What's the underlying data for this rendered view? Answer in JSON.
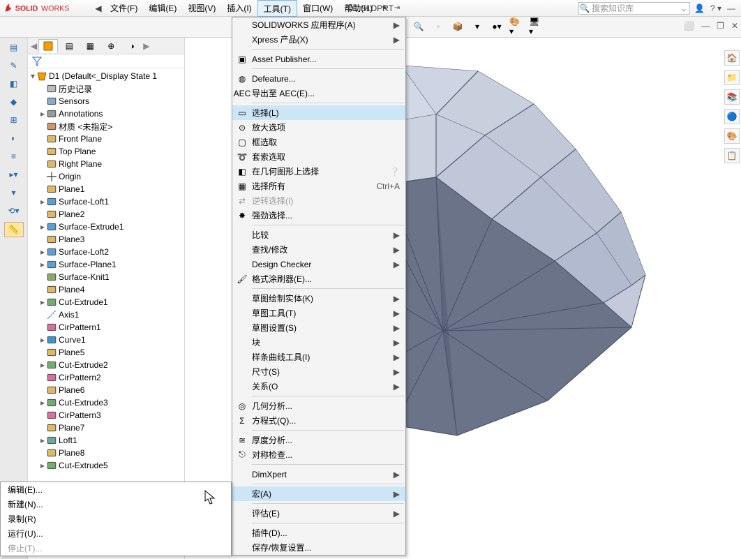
{
  "app": {
    "logo_main": "SOLID",
    "logo_sub": "WORKS",
    "title": "D1.SLDPRT"
  },
  "menubar": {
    "items": [
      "文件(F)",
      "编辑(E)",
      "视图(V)",
      "插入(I)",
      "工具(T)",
      "窗口(W)",
      "帮助(H)"
    ],
    "open_index": 4
  },
  "search": {
    "placeholder": "搜索知识库"
  },
  "feature_tree": {
    "root": "D1  (Default<<Default>_Display State 1",
    "items": [
      {
        "label": "历史记录",
        "icon": "history",
        "exp": ""
      },
      {
        "label": "Sensors",
        "icon": "sensor",
        "exp": ""
      },
      {
        "label": "Annotations",
        "icon": "annot",
        "exp": "▸"
      },
      {
        "label": "材质 <未指定>",
        "icon": "material",
        "exp": ""
      },
      {
        "label": "Front Plane",
        "icon": "plane",
        "exp": ""
      },
      {
        "label": "Top Plane",
        "icon": "plane",
        "exp": ""
      },
      {
        "label": "Right Plane",
        "icon": "plane",
        "exp": ""
      },
      {
        "label": "Origin",
        "icon": "origin",
        "exp": ""
      },
      {
        "label": "Plane1",
        "icon": "plane",
        "exp": ""
      },
      {
        "label": "Surface-Loft1",
        "icon": "surf",
        "exp": "▸"
      },
      {
        "label": "Plane2",
        "icon": "plane",
        "exp": ""
      },
      {
        "label": "Surface-Extrude1",
        "icon": "surf",
        "exp": "▸"
      },
      {
        "label": "Plane3",
        "icon": "plane",
        "exp": ""
      },
      {
        "label": "Surface-Loft2",
        "icon": "surf",
        "exp": "▸"
      },
      {
        "label": "Surface-Plane1",
        "icon": "surf",
        "exp": "▸"
      },
      {
        "label": "Surface-Knit1",
        "icon": "knit",
        "exp": ""
      },
      {
        "label": "Plane4",
        "icon": "plane",
        "exp": ""
      },
      {
        "label": "Cut-Extrude1",
        "icon": "cut",
        "exp": "▸"
      },
      {
        "label": "Axis1",
        "icon": "axis",
        "exp": ""
      },
      {
        "label": "CirPattern1",
        "icon": "pattern",
        "exp": ""
      },
      {
        "label": "Curve1",
        "icon": "curve",
        "exp": "▸"
      },
      {
        "label": "Plane5",
        "icon": "plane",
        "exp": ""
      },
      {
        "label": "Cut-Extrude2",
        "icon": "cut",
        "exp": "▸"
      },
      {
        "label": "CirPattern2",
        "icon": "pattern",
        "exp": ""
      },
      {
        "label": "Plane6",
        "icon": "plane",
        "exp": ""
      },
      {
        "label": "Cut-Extrude3",
        "icon": "cut",
        "exp": "▸"
      },
      {
        "label": "CirPattern3",
        "icon": "pattern",
        "exp": ""
      },
      {
        "label": "Plane7",
        "icon": "plane",
        "exp": ""
      },
      {
        "label": "Loft1",
        "icon": "loft",
        "exp": "▸"
      },
      {
        "label": "Plane8",
        "icon": "plane",
        "exp": ""
      },
      {
        "label": "Cut-Extrude5",
        "icon": "cut",
        "exp": "▸"
      }
    ]
  },
  "tools_menu": [
    {
      "type": "item",
      "label": "SOLIDWORKS 应用程序(A)",
      "sub": true
    },
    {
      "type": "item",
      "label": "Xpress 产品(X)",
      "sub": true
    },
    {
      "type": "sep"
    },
    {
      "type": "item",
      "label": "Asset Publisher...",
      "icon": "asset"
    },
    {
      "type": "sep"
    },
    {
      "type": "item",
      "label": "Defeature...",
      "icon": "defeature"
    },
    {
      "type": "item",
      "label": "导出至 AEC(E)...",
      "icon": "aec"
    },
    {
      "type": "sep"
    },
    {
      "type": "item",
      "label": "选择(L)",
      "icon": "select",
      "hl": true
    },
    {
      "type": "item",
      "label": "放大选项",
      "icon": "zoom"
    },
    {
      "type": "item",
      "label": "框选取",
      "icon": "box"
    },
    {
      "type": "item",
      "label": "套索选取",
      "icon": "lasso"
    },
    {
      "type": "item",
      "label": "在几何图形上选择",
      "icon": "geom",
      "help": true
    },
    {
      "type": "item",
      "label": "选择所有",
      "icon": "selall",
      "shortcut": "Ctrl+A"
    },
    {
      "type": "item",
      "label": "逆转选择(I)",
      "icon": "inv",
      "disabled": true
    },
    {
      "type": "item",
      "label": "强劲选择...",
      "icon": "power"
    },
    {
      "type": "sep"
    },
    {
      "type": "item",
      "label": "比较",
      "sub": true
    },
    {
      "type": "item",
      "label": "查找/修改",
      "sub": true
    },
    {
      "type": "item",
      "label": "Design Checker",
      "sub": true
    },
    {
      "type": "item",
      "label": "格式涂刷器(E)...",
      "icon": "brush"
    },
    {
      "type": "sep"
    },
    {
      "type": "item",
      "label": "草图绘制实体(K)",
      "sub": true
    },
    {
      "type": "item",
      "label": "草图工具(T)",
      "sub": true
    },
    {
      "type": "item",
      "label": "草图设置(S)",
      "sub": true
    },
    {
      "type": "item",
      "label": "块",
      "sub": true
    },
    {
      "type": "item",
      "label": "样条曲线工具(I)",
      "sub": true
    },
    {
      "type": "item",
      "label": "尺寸(S)",
      "sub": true
    },
    {
      "type": "item",
      "label": "关系(O",
      "sub": true
    },
    {
      "type": "sep"
    },
    {
      "type": "item",
      "label": "几何分析...",
      "icon": "geoan"
    },
    {
      "type": "item",
      "label": "方程式(Q)...",
      "icon": "sigma"
    },
    {
      "type": "sep"
    },
    {
      "type": "item",
      "label": "厚度分析...",
      "icon": "thick"
    },
    {
      "type": "item",
      "label": "对称检查...",
      "icon": "sym"
    },
    {
      "type": "sep"
    },
    {
      "type": "item",
      "label": "DimXpert",
      "sub": true
    },
    {
      "type": "sep"
    },
    {
      "type": "item",
      "label": "宏(A)",
      "sub": true,
      "hl": true
    },
    {
      "type": "sep"
    },
    {
      "type": "item",
      "label": "评估(E)",
      "sub": true
    },
    {
      "type": "sep"
    },
    {
      "type": "item",
      "label": "插件(D)..."
    },
    {
      "type": "item",
      "label": "保存/恢复设置..."
    }
  ],
  "macro_submenu": [
    {
      "label": "编辑(E)..."
    },
    {
      "label": "新建(N)..."
    },
    {
      "label": "录制(R)"
    },
    {
      "label": "运行(U)..."
    },
    {
      "label": "停止(T)...",
      "disabled": true
    }
  ]
}
